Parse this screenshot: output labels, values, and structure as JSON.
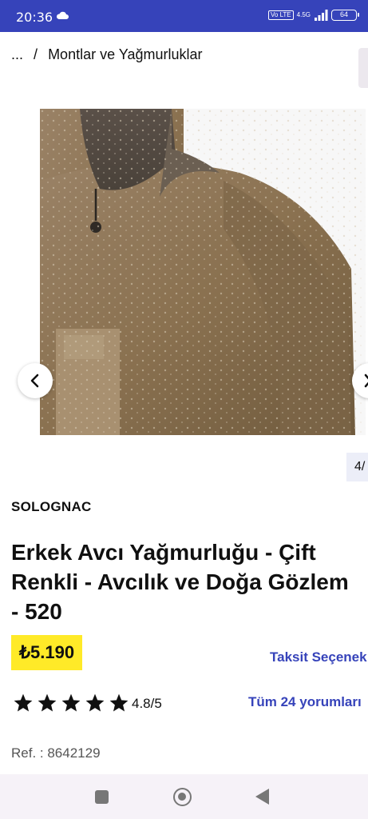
{
  "status_bar": {
    "time": "20:36",
    "network": "4.5G",
    "volte": "Vo LTE",
    "battery": "64",
    "color": "#3643ba"
  },
  "breadcrumb": {
    "ellipsis": "...",
    "separator": "/",
    "current": "Montlar ve Yağmurluklar"
  },
  "gallery": {
    "image_alt": "Haki avcı yağmurluğu üzerinde su damlaları",
    "counter": "4/",
    "prev_icon": "chevron-left-icon",
    "next_icon": "chevron-right-icon"
  },
  "product": {
    "brand": "SOLOGNAC",
    "title": "Erkek Avcı Yağmurluğu - Çift\nRenkli - Avcılık ve Doğa Gözlem\n- 520",
    "price": "₺5.190",
    "price_badge_color": "#ffea28",
    "installments": "Taksit Seçenek",
    "rating": 4.8,
    "rating_text": "4.8/5",
    "stars_filled": 5,
    "reviews_link": "Tüm 24 yorumları",
    "ref": "Ref. : 8642129",
    "accent_color": "#3643ba"
  },
  "nav_bar": {
    "recents_icon": "square-icon",
    "home_icon": "circle-icon",
    "back_icon": "triangle-back-icon"
  }
}
